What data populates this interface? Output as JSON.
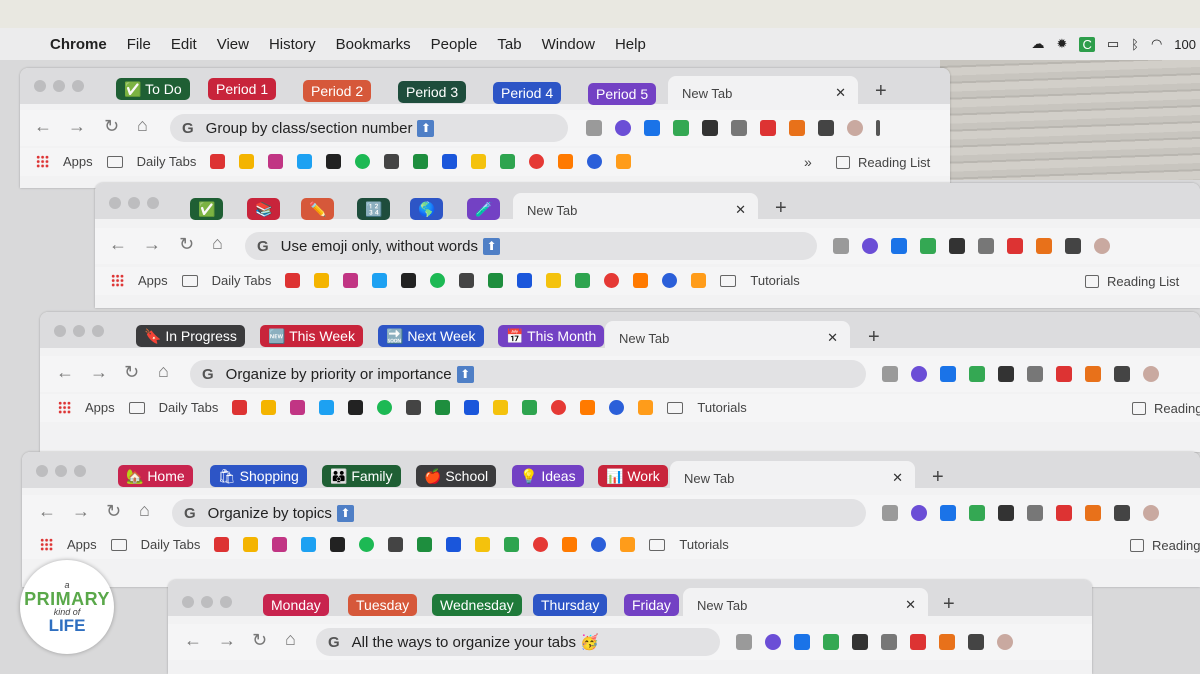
{
  "menubar": {
    "items": [
      "Chrome",
      "File",
      "Edit",
      "View",
      "History",
      "Bookmarks",
      "People",
      "Tab",
      "Window",
      "Help"
    ],
    "status_right": "100"
  },
  "bookmarks": {
    "apps": "Apps",
    "daily_tabs": "Daily Tabs",
    "tutorials": "Tutorials",
    "reading_list": "Reading List",
    "reading_cut": "Reading",
    "more": "»"
  },
  "new_tab": "New Tab",
  "windows": [
    {
      "address": "Group by class/section number",
      "groups": [
        {
          "label": "✅ To Do",
          "color": "#1f5f34"
        },
        {
          "label": "Period 1",
          "color": "#c8243b"
        },
        {
          "label": "Period 2",
          "color": "#d6583a"
        },
        {
          "label": "Period 3",
          "color": "#1e4d3c"
        },
        {
          "label": "Period 4",
          "color": "#2d55c6"
        },
        {
          "label": "Period 5",
          "color": "#7341c4"
        }
      ]
    },
    {
      "address": "Use emoji only, without words",
      "groups": [
        {
          "label": "✅",
          "color": "#1f5f34"
        },
        {
          "label": "📚",
          "color": "#c8243b"
        },
        {
          "label": "✏️",
          "color": "#d6583a"
        },
        {
          "label": "🔢",
          "color": "#1e4d3c"
        },
        {
          "label": "🌎",
          "color": "#2d55c6"
        },
        {
          "label": "🧪",
          "color": "#7341c4"
        }
      ]
    },
    {
      "address": "Organize by priority or importance",
      "groups": [
        {
          "label": "🔖 In Progress",
          "color": "#3b3b3d"
        },
        {
          "label": "🆕 This Week",
          "color": "#c8243b"
        },
        {
          "label": "🔜 Next Week",
          "color": "#2d55c6"
        },
        {
          "label": "📅 This Month",
          "color": "#7341c4"
        }
      ]
    },
    {
      "address": "Organize by topics",
      "groups": [
        {
          "label": "🏡 Home",
          "color": "#c8244e"
        },
        {
          "label": "🛍 Shopping",
          "color": "#2d55c6"
        },
        {
          "label": "👪 Family",
          "color": "#1f5f34"
        },
        {
          "label": "🍎 School",
          "color": "#3b3b3d"
        },
        {
          "label": "💡 Ideas",
          "color": "#7341c4"
        },
        {
          "label": "📊 Work",
          "color": "#c8243b"
        }
      ]
    },
    {
      "address": "All the ways to organize your tabs 🥳",
      "groups": [
        {
          "label": "Monday",
          "color": "#c8244e"
        },
        {
          "label": "Tuesday",
          "color": "#d6583a"
        },
        {
          "label": "Wednesday",
          "color": "#1f7a3a"
        },
        {
          "label": "Thursday",
          "color": "#2d55c6"
        },
        {
          "label": "Friday",
          "color": "#7341c4"
        }
      ]
    }
  ],
  "watermark": {
    "top": "a",
    "main": "PRIMARY",
    "mid": "kind of",
    "bottom": "LIFE"
  }
}
